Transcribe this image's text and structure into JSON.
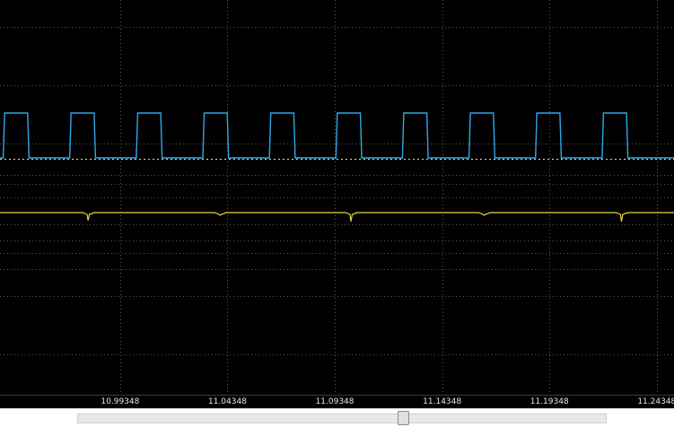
{
  "chart_data": {
    "type": "line",
    "xlabel": "",
    "ylabel": "",
    "x_ticks": [
      "10.99348",
      "11.04348",
      "11.09348",
      "11.14348",
      "11.19348",
      "11.24348"
    ],
    "x_range": [
      10.9375,
      11.2515
    ],
    "grid": true,
    "series": [
      {
        "color": "#2ea8e8",
        "waveform": "pulse_train",
        "high_level": 1,
        "low_level": 0,
        "pulses": [
          [
            10.939,
            10.951
          ],
          [
            10.97,
            10.982
          ],
          [
            11.001,
            11.013
          ],
          [
            11.032,
            11.044
          ],
          [
            11.063,
            11.075
          ],
          [
            11.094,
            11.106
          ],
          [
            11.125,
            11.137
          ],
          [
            11.156,
            11.168
          ],
          [
            11.187,
            11.199
          ],
          [
            11.218,
            11.23
          ]
        ]
      },
      {
        "color": "#e8d23a",
        "waveform": "baseline_with_dips",
        "baseline": 0,
        "dips": [
          {
            "x": 10.9785,
            "depth": 0.35
          },
          {
            "x": 11.04,
            "depth": 0.12
          },
          {
            "x": 11.101,
            "depth": 0.4
          },
          {
            "x": 11.163,
            "depth": 0.12
          },
          {
            "x": 11.227,
            "depth": 0.4
          }
        ]
      }
    ]
  },
  "colors": {
    "background": "#000000",
    "grid": "#5a5a5a",
    "reference": "#e8e4a0"
  }
}
